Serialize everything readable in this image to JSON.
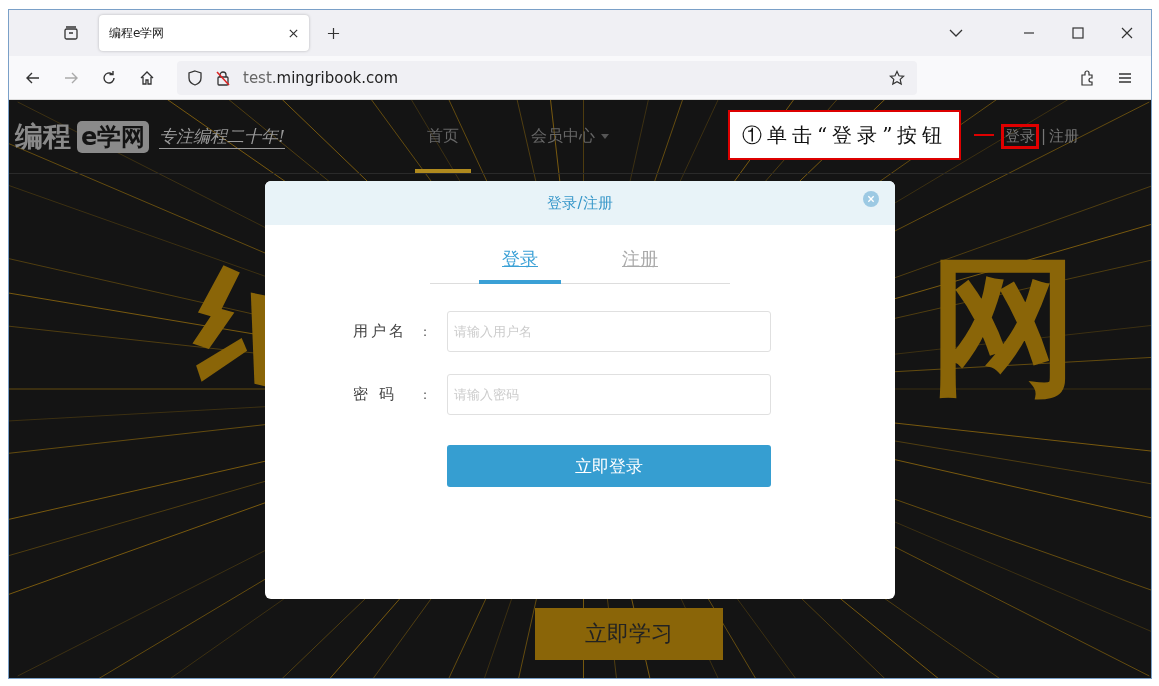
{
  "browser": {
    "tab": {
      "title": "编程e学网",
      "selected": true
    },
    "address": {
      "prefix": "test.",
      "domain": "mingribook.com"
    }
  },
  "site": {
    "logo": {
      "name": "编程",
      "badge": "e学网"
    },
    "slogan": "专注编程二十年!",
    "nav": [
      {
        "label": "首页",
        "selected": true,
        "dropdown": false
      },
      {
        "label": "会员中心",
        "selected": false,
        "dropdown": true
      }
    ],
    "auth": {
      "login": "登录",
      "separator": "|",
      "register": "注册"
    },
    "hero": {
      "right_char": "网",
      "button": "立即学习"
    }
  },
  "annotation": {
    "text": "①单击“登录”按钮"
  },
  "dialog": {
    "title": "登录/注册",
    "tabs": [
      {
        "label": "登录",
        "selected": true
      },
      {
        "label": "注册",
        "selected": false
      }
    ],
    "fields": [
      {
        "label": "用户名",
        "colon": ":",
        "placeholder": "请输入用户名"
      },
      {
        "label": "密 码",
        "colon": ":",
        "placeholder": "请输入密码"
      }
    ],
    "submit": "立即登录"
  }
}
